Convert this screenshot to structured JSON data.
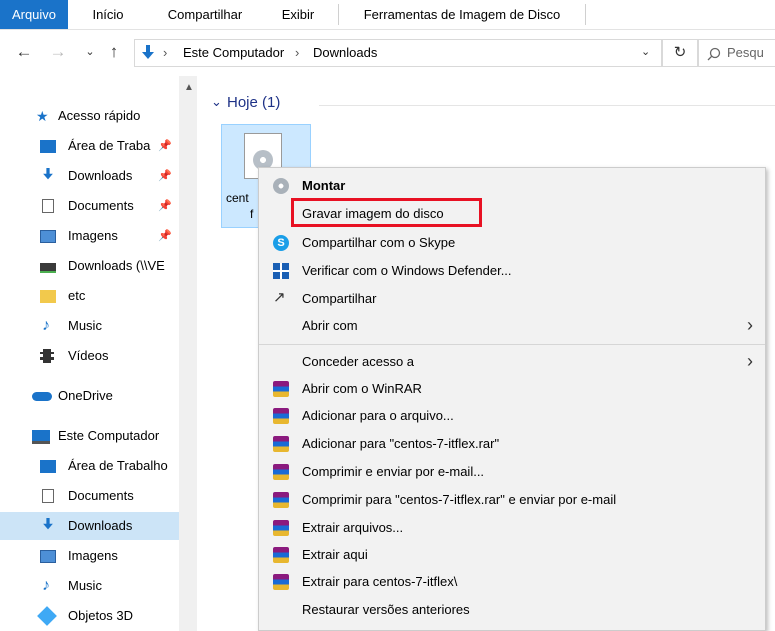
{
  "ribbon": {
    "tabs": [
      "Arquivo",
      "Início",
      "Compartilhar",
      "Exibir",
      "Ferramentas de Imagem de Disco"
    ],
    "active_tab": "Arquivo",
    "accent_color": "#1a73c9"
  },
  "address": {
    "crumbs": [
      "Este Computador",
      "Downloads"
    ],
    "search_placeholder": "Pesqu"
  },
  "nav": {
    "quick_access": "Acesso rápido",
    "quick_items": [
      "Área de Traba",
      "Downloads",
      "Documents",
      "Imagens",
      "Downloads (\\\\VE",
      "etc",
      "Music",
      "Vídeos"
    ],
    "onedrive": "OneDrive",
    "this_pc": "Este Computador",
    "pc_items": [
      "Área de Trabalho",
      "Documents",
      "Downloads",
      "Imagens",
      "Music",
      "Objetos 3D"
    ],
    "selected": "Downloads"
  },
  "content": {
    "group_header": "Hoje (1)",
    "file_label_line1": "cent",
    "file_label_line2": "f"
  },
  "menu": {
    "items": [
      {
        "label": "Montar",
        "icon": "disc-icon",
        "bold": true
      },
      {
        "label": "Gravar imagem do disco",
        "icon": "",
        "highlighted": true
      },
      {
        "label": "Compartilhar com o Skype",
        "icon": "skype-icon"
      },
      {
        "label": "Verificar com o Windows Defender...",
        "icon": "defender-icon"
      },
      {
        "label": "Compartilhar",
        "icon": "share-icon"
      },
      {
        "label": "Abrir com",
        "icon": "",
        "submenu": true
      },
      {
        "label": "Conceder acesso a",
        "icon": "",
        "submenu": true
      },
      {
        "label": "Abrir com o WinRAR",
        "icon": "winrar-icon"
      },
      {
        "label": "Adicionar para o arquivo...",
        "icon": "winrar-icon"
      },
      {
        "label": "Adicionar para \"centos-7-itflex.rar\"",
        "icon": "winrar-icon"
      },
      {
        "label": "Comprimir e enviar por e-mail...",
        "icon": "winrar-icon"
      },
      {
        "label": "Comprimir para \"centos-7-itflex.rar\" e enviar por e-mail",
        "icon": "winrar-icon"
      },
      {
        "label": "Extrair arquivos...",
        "icon": "winrar-icon"
      },
      {
        "label": "Extrair aqui",
        "icon": "winrar-icon"
      },
      {
        "label": "Extrair para centos-7-itflex\\",
        "icon": "winrar-icon"
      },
      {
        "label": "Restaurar versões anteriores",
        "icon": ""
      }
    ],
    "highlight_color": "#e81123"
  }
}
